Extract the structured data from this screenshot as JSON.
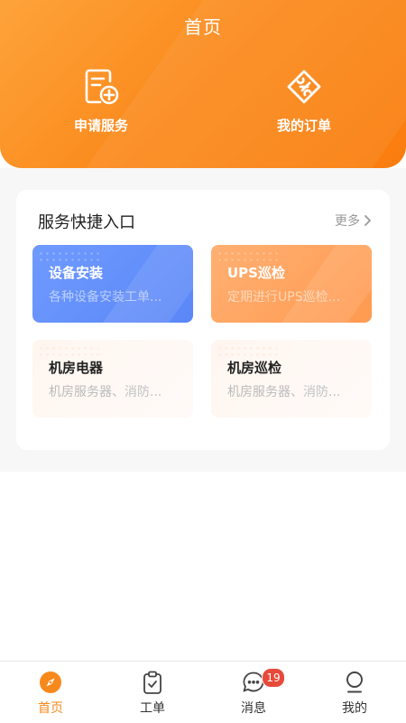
{
  "header": {
    "title": "首页",
    "actions": [
      {
        "label": "申请服务",
        "icon": "add-document-icon"
      },
      {
        "label": "我的订单",
        "icon": "ticket-icon"
      }
    ]
  },
  "services": {
    "title": "服务快捷入口",
    "more_label": "更多",
    "tiles": [
      {
        "title": "设备安装",
        "desc": "各种设备安装工单...",
        "color": "#6289fa"
      },
      {
        "title": "UPS巡检",
        "desc": "定期进行UPS巡检...",
        "color": "#ffa25f"
      },
      {
        "title": "机房电器",
        "desc": "机房服务器、消防..."
      },
      {
        "title": "机房巡检",
        "desc": "机房服务器、消防..."
      }
    ]
  },
  "tabbar": {
    "items": [
      {
        "label": "首页",
        "icon": "compass-icon",
        "active": true
      },
      {
        "label": "工单",
        "icon": "clipboard-icon"
      },
      {
        "label": "消息",
        "icon": "chat-bubble-icon",
        "badge": "19"
      },
      {
        "label": "我的",
        "icon": "user-icon"
      }
    ]
  },
  "colors": {
    "accent": "#f7891c",
    "header_start": "#fda33a",
    "header_end": "#fa7d0e",
    "badge": "#e84a3a"
  }
}
